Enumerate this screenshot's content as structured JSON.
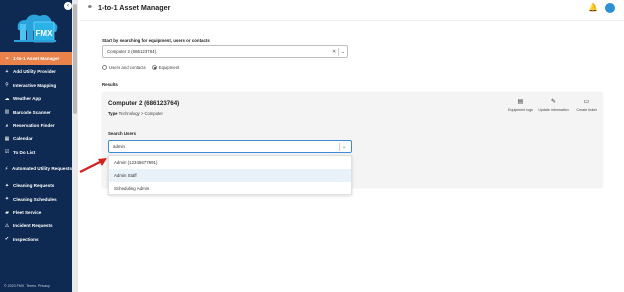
{
  "sidebar": {
    "logo_text": "FMX",
    "items": [
      {
        "label": "1-to-1 Asset Manager",
        "icon": "asset-icon",
        "glyph": "⚭",
        "active": true
      },
      {
        "label": "Add Utility Provider",
        "icon": "plus-icon",
        "glyph": "+"
      },
      {
        "label": "Interactive Mapping",
        "icon": "map-pin-icon",
        "glyph": "⚲"
      },
      {
        "label": "Weather App",
        "icon": "cloud-icon",
        "glyph": "☁"
      },
      {
        "label": "Barcode Scanner",
        "icon": "barcode-icon",
        "glyph": "▥"
      },
      {
        "label": "Reservation Finder",
        "icon": "search-icon",
        "glyph": "⌕"
      },
      {
        "label": "Calendar",
        "icon": "calendar-icon",
        "glyph": "▦"
      },
      {
        "label": "To Do List",
        "icon": "checklist-icon",
        "glyph": "☑"
      },
      {
        "label": "Automated Utility Requests",
        "icon": "bolt-icon",
        "glyph": "⚡",
        "tall": true
      },
      {
        "label": "Cleaning Requests",
        "icon": "broom-icon",
        "glyph": "✦"
      },
      {
        "label": "Cleaning Schedules",
        "icon": "schedule-icon",
        "glyph": "✦"
      },
      {
        "label": "Fleet Service",
        "icon": "car-icon",
        "glyph": "▰"
      },
      {
        "label": "Incident Requests",
        "icon": "alert-icon",
        "glyph": "⚠"
      },
      {
        "label": "Inspections",
        "icon": "check-icon",
        "glyph": "✔"
      }
    ],
    "footer": {
      "copyright": "© 2023 FMX",
      "terms": "Terms",
      "privacy": "Privacy"
    }
  },
  "header": {
    "title": "1-to-1 Asset Manager"
  },
  "search": {
    "label": "Start by searching for equipment, users or contacts",
    "value": "Computer 2 (686123764)",
    "options": [
      {
        "label": "Users and contacts",
        "selected": false
      },
      {
        "label": "Equipment",
        "selected": true
      }
    ]
  },
  "results": {
    "label": "Results",
    "card": {
      "name": "Computer 2 (686123764)",
      "type_label": "Type",
      "type_value": "Technology > Computer",
      "actions": [
        {
          "label": "Equipment logs",
          "icon": "book-icon",
          "glyph": "▤"
        },
        {
          "label": "Update information",
          "icon": "pencil-icon",
          "glyph": "✎"
        },
        {
          "label": "Create ticket",
          "icon": "monitor-icon",
          "glyph": "▭"
        }
      ],
      "search_users": {
        "label": "Search Users",
        "value": "admin"
      }
    }
  },
  "dropdown": {
    "options": [
      "Admin (12345677891)",
      "Admin Staff",
      "Scheduling Admin"
    ],
    "highlighted_index": 1
  }
}
